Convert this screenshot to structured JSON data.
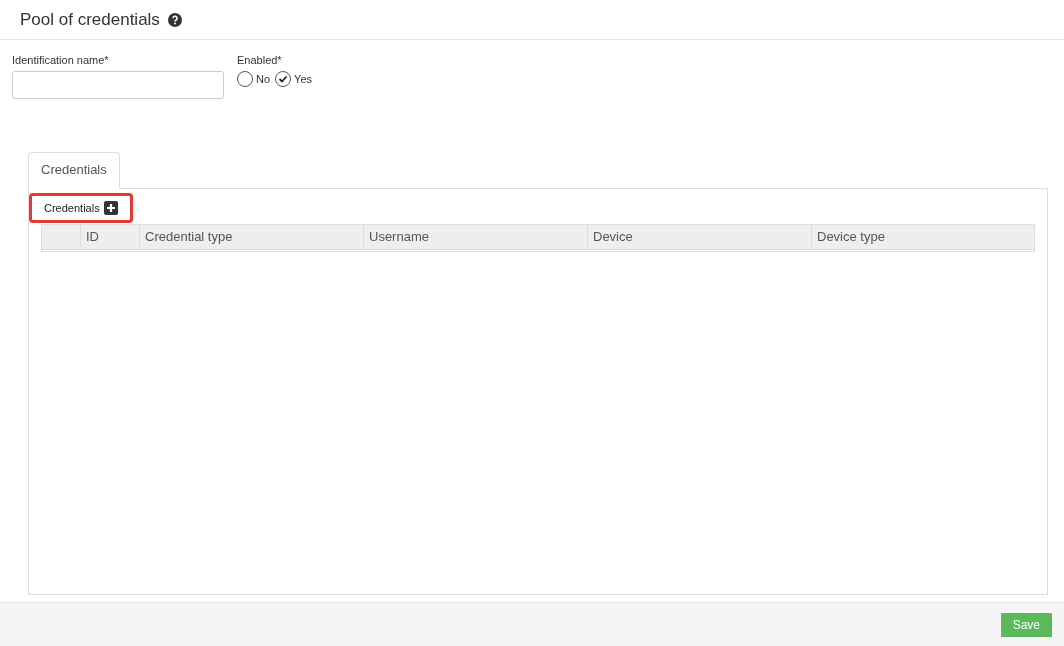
{
  "header": {
    "title": "Pool of credentials"
  },
  "form": {
    "name_field": {
      "label": "Identification name*"
    },
    "enabled": {
      "label": "Enabled*",
      "options": [
        {
          "label": "No",
          "selected": false
        },
        {
          "label": "Yes",
          "selected": true
        }
      ]
    }
  },
  "tabs": [
    {
      "label": "Credentials",
      "selected": true
    }
  ],
  "section": {
    "label": "Credentials",
    "highlighted": true
  },
  "table": {
    "columns": [
      "ID",
      "Credential type",
      "Username",
      "Device",
      "Device type"
    ]
  },
  "footer": {
    "buttons": [
      "Save"
    ]
  }
}
